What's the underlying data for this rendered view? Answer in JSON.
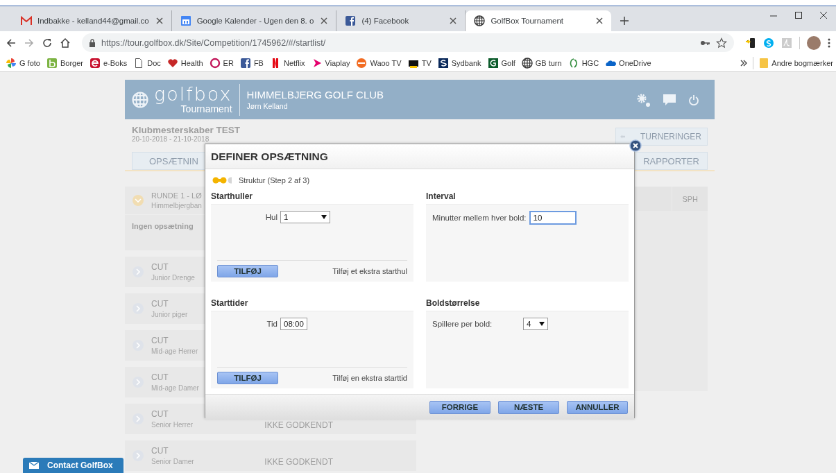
{
  "browser": {
    "tabs": [
      {
        "title": "Indbakke - kelland44@gmail.co",
        "selected": false
      },
      {
        "title": "Google Kalender - Ugen den 8. o",
        "selected": false
      },
      {
        "title": "(4) Facebook",
        "selected": false
      },
      {
        "title": "GolfBox Tournament",
        "selected": true
      }
    ],
    "url": "https://tour.golfbox.dk/Site/Competition/1745962/#/startlist/",
    "bookmarks": [
      "G foto",
      "Borger",
      "e-Boks",
      "Doc",
      "Health",
      "ER",
      "FB",
      "Netflix",
      "Viaplay",
      "Waoo TV",
      "TV",
      "Sydbank",
      "Golf",
      "GB turn",
      "HGC",
      "OneDrive"
    ],
    "other_bookmarks": "Andre bogmærker"
  },
  "app": {
    "logo": "golfbox",
    "logo_subtitle": "Tournament",
    "club": "HIMMELBJERG GOLF CLUB",
    "user": "Jørn Kelland",
    "competition": "Klubmesterskaber TEST",
    "dates": "20-10-2018 - 21-10-2018",
    "back_button": "TURNERINGER",
    "tabs": [
      "OPSÆTNIN",
      "RAPPORTER"
    ],
    "round": {
      "title": "RUNDE 1 - LØ",
      "course": "Himmelbjergban",
      "note": "Ingen opsætning"
    },
    "rows": [
      {
        "title": "CUT",
        "subtitle": "Junior Drenge"
      },
      {
        "title": "CUT",
        "subtitle": "Junior piger"
      },
      {
        "title": "CUT",
        "subtitle": "Mid-age Herrer"
      },
      {
        "title": "CUT",
        "subtitle": "Mid-age Damer"
      },
      {
        "title": "CUT",
        "subtitle": "Senior Herrer",
        "status": "IKKE GODKENDT"
      },
      {
        "title": "CUT",
        "subtitle": "Senior Damer",
        "status": "IKKE GODKENDT"
      }
    ],
    "right_panel": {
      "column_1": "SPH"
    }
  },
  "dialog": {
    "title": "DEFINER OPSÆTNING",
    "steps": [
      {
        "done": true
      },
      {
        "done": true
      },
      {
        "done": false
      }
    ],
    "step_label": "Struktur (Step 2 af 3)",
    "sections": [
      {
        "heading": "Starthuller",
        "field": {
          "label": "Hul",
          "value": "1",
          "kind": "select",
          "focused": false
        },
        "add_button": "TILFØJ",
        "add_hint": "Tilføj et ekstra starthul"
      },
      {
        "heading": "Interval",
        "field": {
          "label": "Minutter mellem hver bold:",
          "value": "10",
          "kind": "text",
          "focused": true
        }
      },
      {
        "heading": "Starttider",
        "field": {
          "label": "Tid",
          "value": "08:00",
          "kind": "text",
          "focused": false
        },
        "add_button": "TILFØJ",
        "add_hint": "Tilføj en ekstra starttid"
      },
      {
        "heading": "Boldstørrelse",
        "field": {
          "label": "Spillere per bold:",
          "value": "4",
          "kind": "select",
          "focused": false
        }
      }
    ],
    "buttons": [
      "FORRIGE",
      "NÆSTE",
      "ANNULLER"
    ]
  },
  "contact_button": "Contact GolfBox"
}
